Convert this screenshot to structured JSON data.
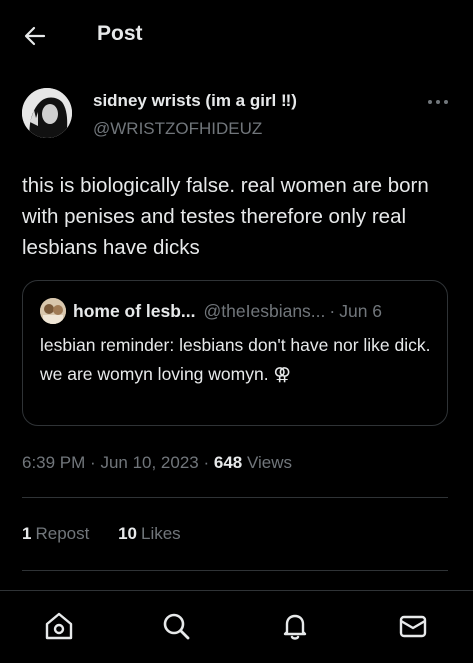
{
  "header": {
    "title": "Post"
  },
  "post": {
    "display_name": "sidney wrists (im a girl ‼)",
    "handle": "@WRISTZOFHIDEUZ",
    "text": "this is biologically false. real women are born with penises and testes therefore only real lesbians have dicks",
    "time": "6:39 PM",
    "date": "Jun 10, 2023",
    "views_count": "648",
    "views_label": "Views"
  },
  "quote": {
    "name": "home of lesb...",
    "handle": "@theIesbians...",
    "separator": "·",
    "date": "Jun 6",
    "text": "lesbian reminder: lesbians don't have nor like dick.\nwe are womyn loving womyn. ⚢"
  },
  "stats": {
    "reposts_count": "1",
    "reposts_label": "Repost",
    "likes_count": "10",
    "likes_label": "Likes"
  },
  "icons": {
    "back": "back-arrow-icon",
    "more": "more-icon",
    "home": "home-icon",
    "search": "search-icon",
    "notifications": "bell-icon",
    "messages": "mail-icon"
  },
  "colors": {
    "background": "#000000",
    "text_primary": "#e7e9ea",
    "text_secondary": "#71767b",
    "border": "#2f3336"
  }
}
